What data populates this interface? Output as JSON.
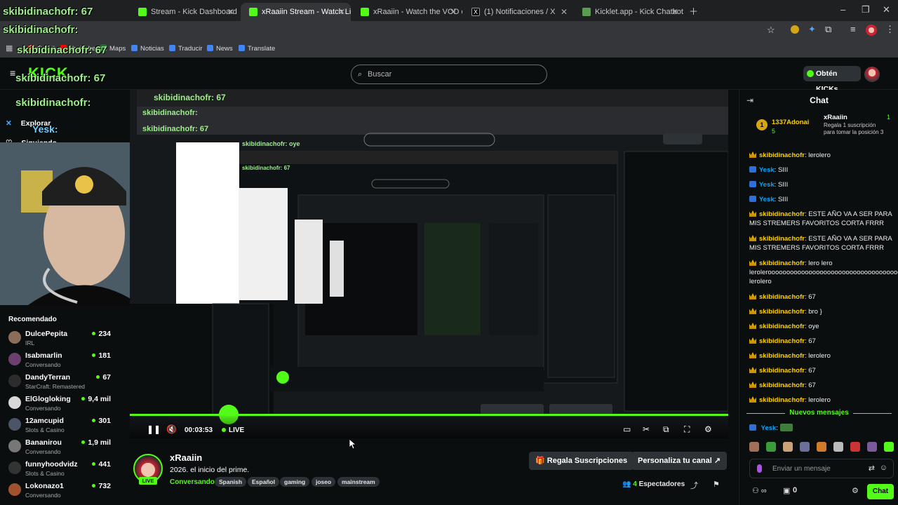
{
  "browser": {
    "tabs": [
      {
        "label": "skibidinachofr: 67",
        "color": "#53fc18"
      },
      {
        "label": "Stream - Kick Dashboard",
        "color": "#53fc18"
      },
      {
        "label": "xRaaiin Stream - Watch Live",
        "color": "#53fc18"
      },
      {
        "label": "xRaaiin - Watch the VOD on Kick",
        "color": "#53fc18"
      },
      {
        "label": "(1) Notificaciones / X",
        "color": "#ffffff"
      },
      {
        "label": "Kicklet.app - Kick Chatbot and",
        "color": "#5a9d4e"
      }
    ],
    "bookmarks": [
      {
        "label": "Gmail",
        "color": "#ea4335"
      },
      {
        "label": "YouTube",
        "color": "#ff0000"
      },
      {
        "label": "Maps",
        "color": "#34a853"
      },
      {
        "label": "Noticias",
        "color": "#4285f4"
      },
      {
        "label": "Traducir",
        "color": "#4285f4"
      },
      {
        "label": "News",
        "color": "#4285f4"
      },
      {
        "label": "Translate",
        "color": "#4285f4"
      }
    ]
  },
  "nav": {
    "search_placeholder": "Buscar",
    "kicks_button": "Obtén KICKs"
  },
  "sidebar": {
    "explore": "Explorar",
    "following": "Siguiendo",
    "recommended_title": "Recomendado",
    "recommended": [
      {
        "name": "DulcePepita",
        "category": "IRL",
        "viewers": "234",
        "color": "#8a6e5a"
      },
      {
        "name": "Isabmarlin",
        "category": "Conversando",
        "viewers": "181",
        "color": "#6b3f6e"
      },
      {
        "name": "DandyTerran",
        "category": "StarCraft: Remastered",
        "viewers": "67",
        "color": "#2c2c2c"
      },
      {
        "name": "ElGlogloking",
        "category": "Conversando",
        "viewers": "9,4 mil",
        "color": "#d8d8d8"
      },
      {
        "name": "12amcupid",
        "category": "Slots & Casino",
        "viewers": "301",
        "color": "#4a5568"
      },
      {
        "name": "Bananirou",
        "category": "Conversando",
        "viewers": "1,9 mil",
        "color": "#777777"
      },
      {
        "name": "funnyhoodvidz",
        "category": "Slots & Casino",
        "viewers": "441",
        "color": "#333333"
      },
      {
        "name": "Lokonazo1",
        "category": "Conversando",
        "viewers": "732",
        "color": "#a0522d"
      }
    ]
  },
  "overlay": {
    "line1": "skibidinachofr: 67",
    "line2": "skibidinachofr:",
    "line3": "skibidinachofr: 67",
    "line4": "skibidinachofr: 67",
    "line5": "skibidinachofr:",
    "line6": "Yesk:"
  },
  "player": {
    "time": "00:03:53",
    "live": "LIVE"
  },
  "channel": {
    "name": "xRaaiin",
    "title": "2026. el inicio del prime.",
    "category": "Conversando",
    "live_badge": "LIVE",
    "tags": [
      "Spanish",
      "Español",
      "gaming",
      "joseo",
      "mainstream"
    ],
    "gift_button": "Regala Suscripciones",
    "customize_button": "Personaliza tu canal",
    "viewers_count": "4",
    "viewers_label": "Espectadores"
  },
  "chat": {
    "title": "Chat",
    "pinned": {
      "top_user": "1337Adonai",
      "top_rank": "1",
      "top_count": "5",
      "user": "xRaaiin",
      "count": "1",
      "text": "Regala 1 suscripción para tomar la posición 3"
    },
    "messages": [
      {
        "user": "skibidinachofr",
        "text": "lerolero",
        "badge": "crown",
        "color": "#ffd000"
      },
      {
        "user": "Yesk",
        "text": "SIII",
        "badge": "bot",
        "color": "#00a8ff"
      },
      {
        "user": "Yesk",
        "text": "SIII",
        "badge": "bot",
        "color": "#00a8ff"
      },
      {
        "user": "Yesk",
        "text": "SIII",
        "badge": "bot",
        "color": "#00a8ff"
      },
      {
        "user": "skibidinachofr",
        "text": "ESTE AÑO VA A SER PARA MIS STREMERS FAVORITOS CORTA FRRR",
        "badge": "crown",
        "color": "#ffd000"
      },
      {
        "user": "skibidinachofr",
        "text": "ESTE AÑO VA A SER PARA MIS STREMERS FAVORITOS CORTA FRRR",
        "badge": "crown",
        "color": "#ffd000"
      },
      {
        "user": "skibidinachofr",
        "text": "lero lero lerolerooooooooooooooooooooooooooooooooooooooooooooo lerolero",
        "badge": "crown",
        "color": "#ffd000"
      },
      {
        "user": "skibidinachofr",
        "text": "67",
        "badge": "crown",
        "color": "#ffd000"
      },
      {
        "user": "skibidinachofr",
        "text": "bro }",
        "badge": "crown",
        "color": "#ffd000"
      },
      {
        "user": "skibidinachofr",
        "text": "oye",
        "badge": "crown",
        "color": "#ffd000"
      },
      {
        "user": "skibidinachofr",
        "text": "67",
        "badge": "crown",
        "color": "#ffd000"
      },
      {
        "user": "skibidinachofr",
        "text": "lerolero",
        "badge": "crown",
        "color": "#ffd000"
      },
      {
        "user": "skibidinachofr",
        "text": "67",
        "badge": "crown",
        "color": "#ffd000"
      },
      {
        "user": "skibidinachofr",
        "text": "67",
        "badge": "crown",
        "color": "#ffd000"
      },
      {
        "user": "skibidinachofr",
        "text": "lerolero",
        "badge": "crown",
        "color": "#ffd000"
      }
    ],
    "new_messages": "Nuevos mensajes",
    "last_message": {
      "user": "Yesk",
      "badge": "bot",
      "color": "#00a8ff"
    },
    "input_placeholder": "Enviar un mensaje",
    "footer_count": "0",
    "send_button": "Chat"
  }
}
